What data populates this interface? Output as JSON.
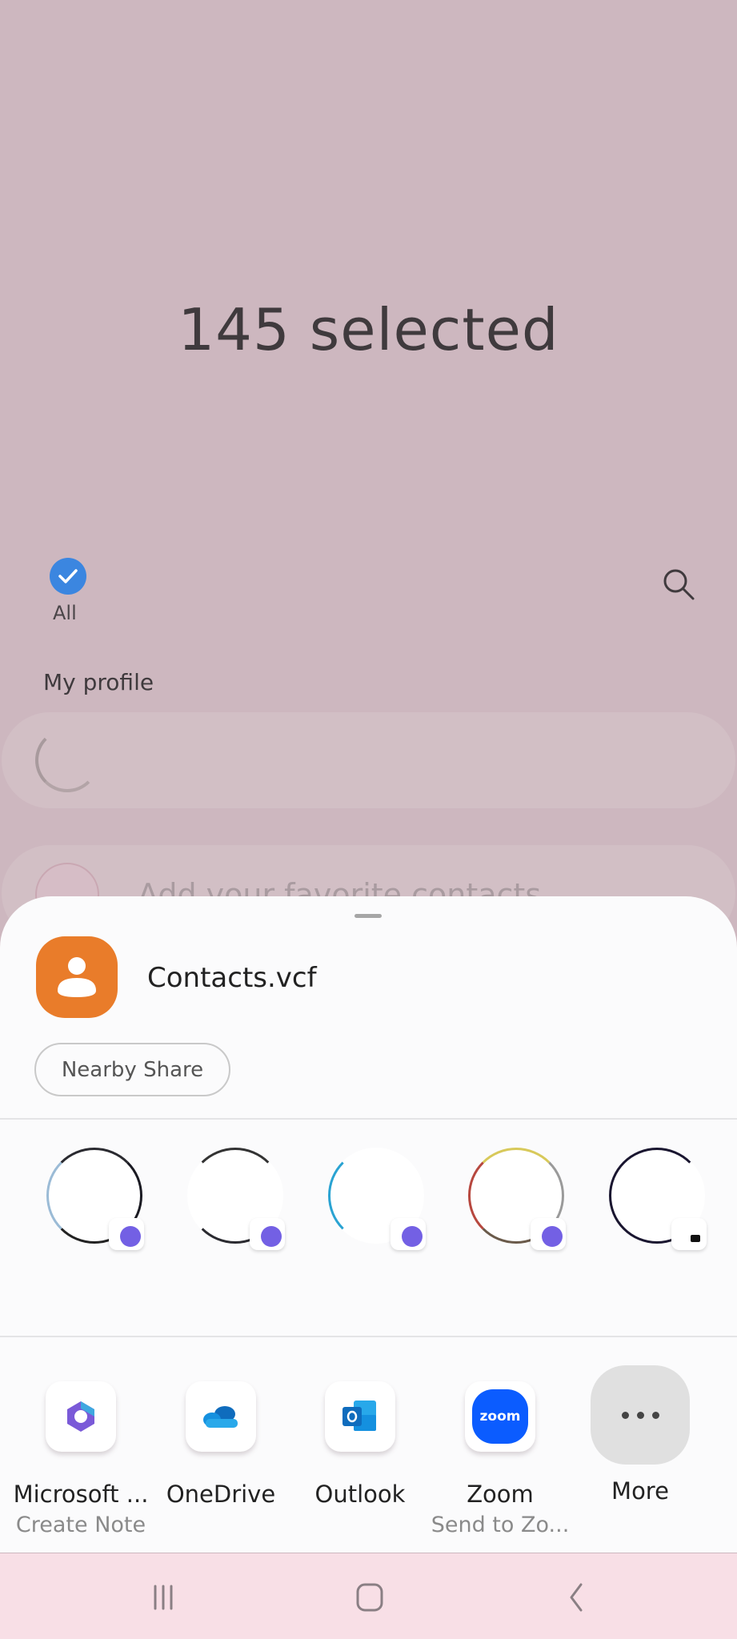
{
  "header": {
    "title": "145 selected"
  },
  "toolbar": {
    "all_label": "All",
    "search_icon": "search-icon"
  },
  "list": {
    "section_label": "My profile",
    "favorites_placeholder": "Add your favorite contacts"
  },
  "share_sheet": {
    "file_name": "Contacts.vcf",
    "file_icon": "contact-person-icon",
    "file_icon_color": "#e97c2a",
    "nearby_share_label": "Nearby Share",
    "direct_share_targets": [
      {
        "avatar": "contact-avatar-icon",
        "badge": "viber-badge-icon"
      },
      {
        "avatar": "contact-avatar-icon",
        "badge": "viber-badge-icon"
      },
      {
        "avatar": "contact-avatar-icon",
        "badge": "viber-badge-icon"
      },
      {
        "avatar": "contact-avatar-icon",
        "badge": "viber-badge-icon"
      },
      {
        "avatar": "contact-avatar-icon",
        "badge": "messages-badge-icon"
      }
    ],
    "apps": [
      {
        "name": "Microsoft ...",
        "sub": "Create Note",
        "icon": "microsoft-365-icon"
      },
      {
        "name": "OneDrive",
        "sub": "",
        "icon": "onedrive-icon"
      },
      {
        "name": "Outlook",
        "sub": "",
        "icon": "outlook-icon"
      },
      {
        "name": "Zoom",
        "sub": "Send to Zo...",
        "icon": "zoom-icon",
        "icon_text": "zoom"
      },
      {
        "name": "More",
        "sub": "",
        "icon": "more-icon"
      }
    ]
  },
  "navbar": {
    "recents": "recents-icon",
    "home": "home-icon",
    "back": "back-icon"
  },
  "colors": {
    "accent": "#3b86e0",
    "scrim": "#cdb7bf",
    "sheet": "#fbfbfc",
    "navbar": "#f8dfe6",
    "zoom_blue": "#0b5cff",
    "viber_purple": "#7360e4"
  }
}
